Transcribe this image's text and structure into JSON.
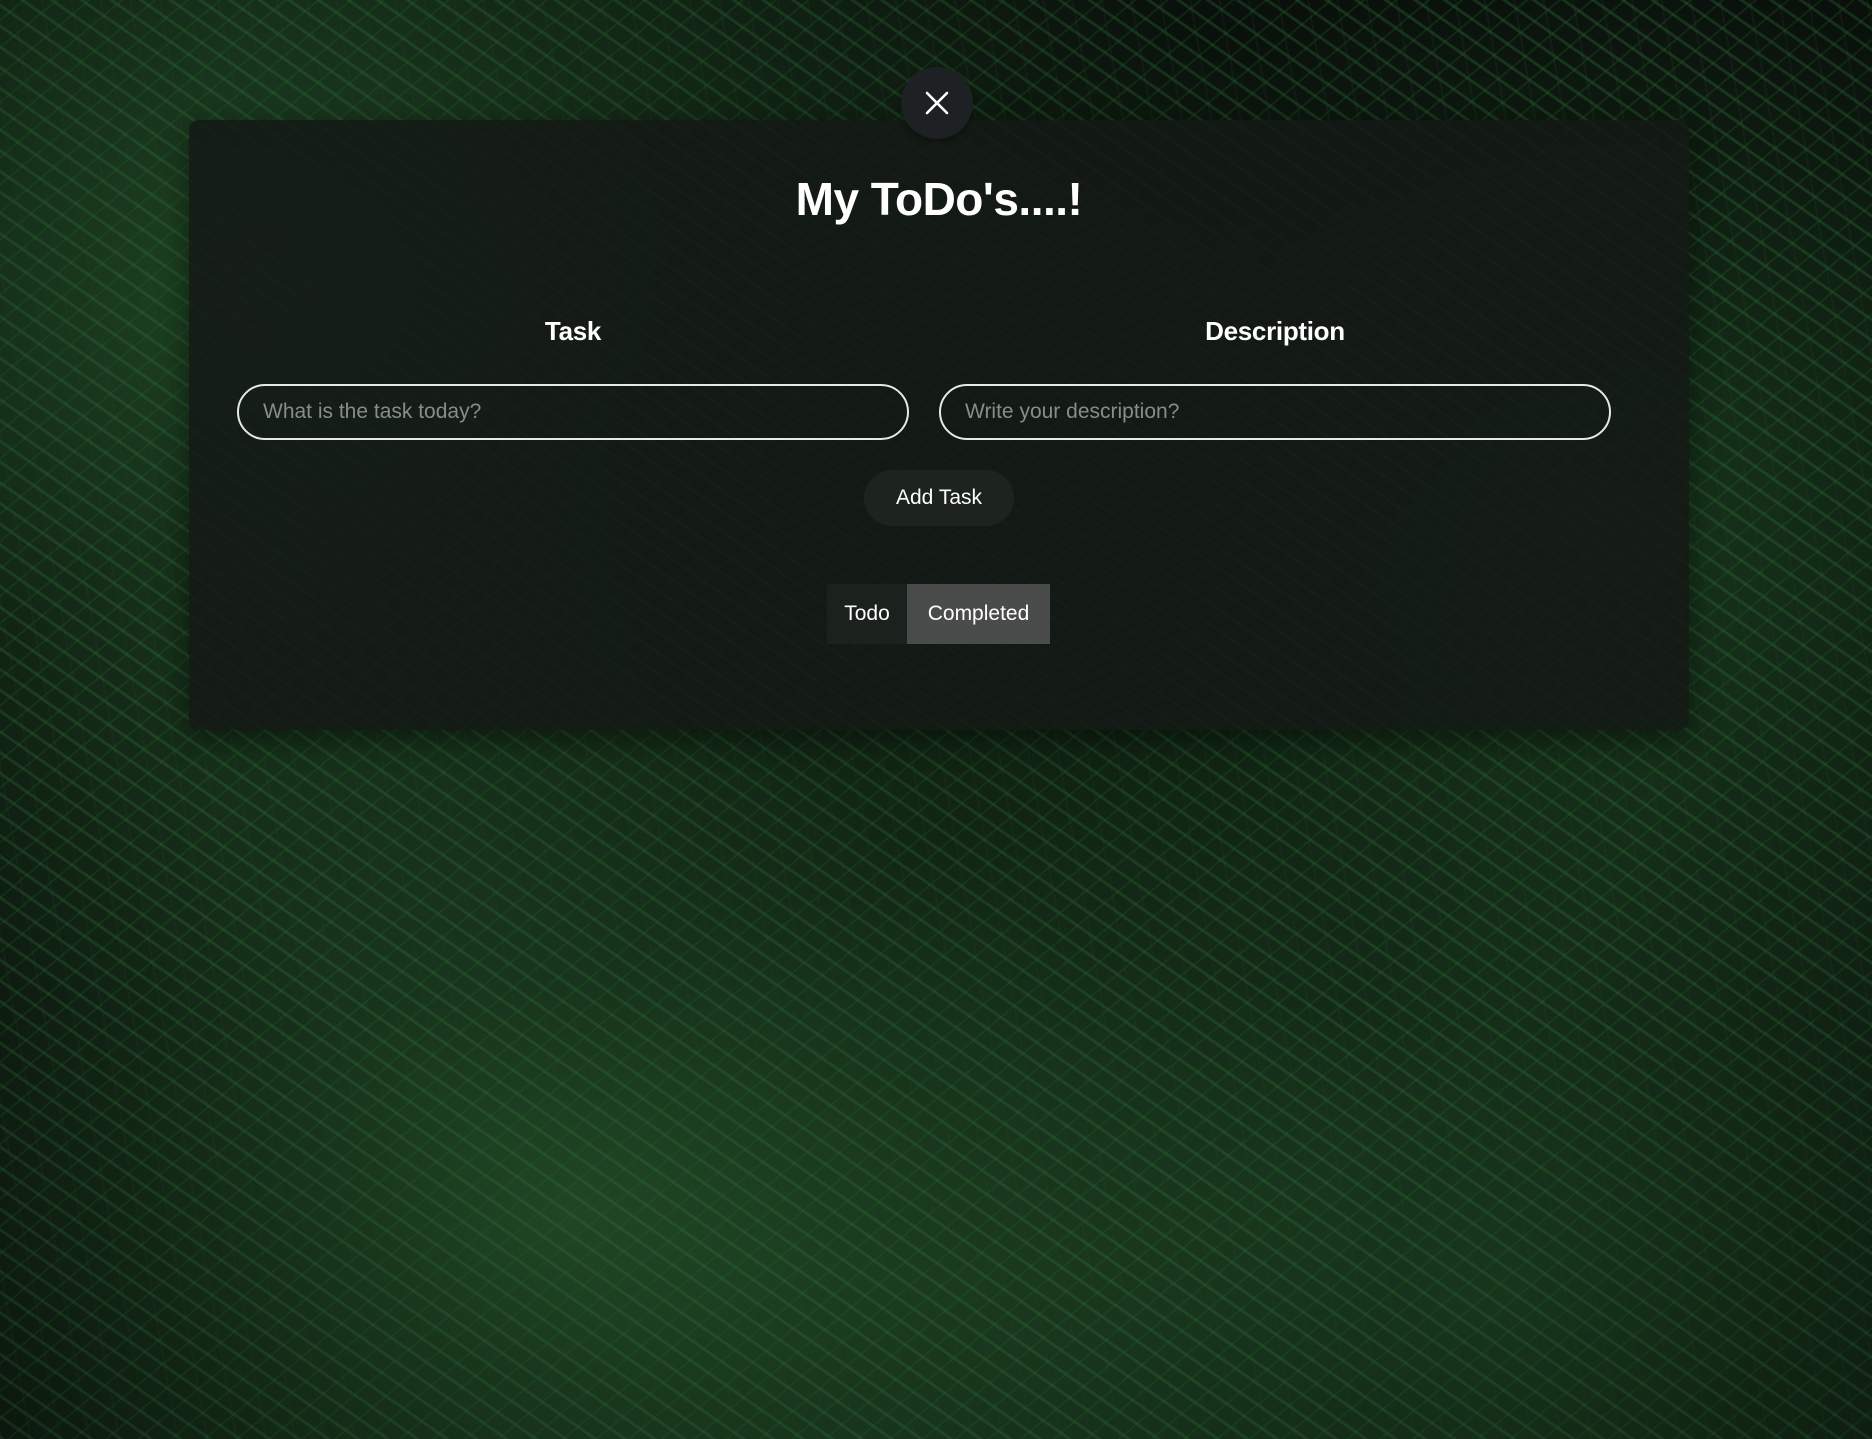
{
  "app": {
    "title": "My ToDo's....!"
  },
  "close": {
    "icon": "close-icon"
  },
  "form": {
    "task_label": "Task",
    "task_placeholder": "What is the task today?",
    "task_value": "",
    "description_label": "Description",
    "description_placeholder": "Write your description?",
    "description_value": "",
    "add_button_label": "Add Task"
  },
  "tabs": [
    {
      "label": "Todo",
      "active": false
    },
    {
      "label": "Completed",
      "active": true
    }
  ],
  "colors": {
    "card_background": "#141815",
    "active_tab": "#4a4b4b",
    "inactive_tab": "#1b211d",
    "accent_text": "#ffffff",
    "background_foliage": "#2e6e34"
  }
}
